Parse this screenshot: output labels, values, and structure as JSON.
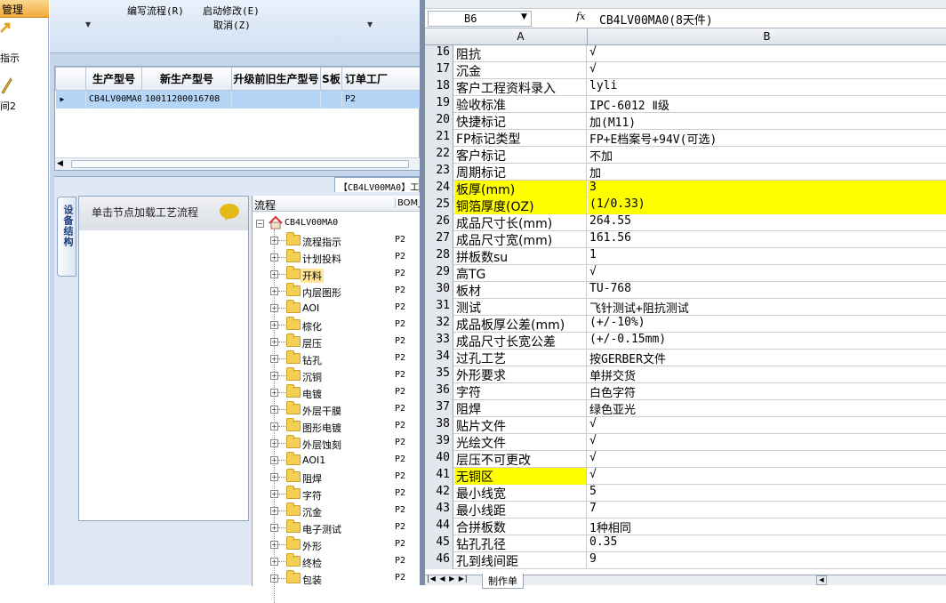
{
  "left_strip": {
    "header": "管理",
    "items": [
      {
        "label": "指示",
        "icon": "task-arrow-icon"
      },
      {
        "label": "间2",
        "icon": "pencil-icon"
      }
    ]
  },
  "ribbon": {
    "items": [
      {
        "label": "编写流程(R)"
      },
      {
        "label": "启动修改(E)"
      },
      {
        "label": "取消(Z)"
      }
    ],
    "dropdown_arrow": "▼"
  },
  "grid": {
    "columns": [
      "生产型号",
      "新生产型号",
      "升级前旧生产型号",
      "S板",
      "订单工厂"
    ],
    "rows": [
      [
        "CB4LV00MA0",
        "10011200016708",
        "",
        "",
        "P2"
      ]
    ]
  },
  "lower": {
    "vertical_tab": "设备结构",
    "top_tab": "【CB4LV00MA0】工",
    "panel_header": "单击节点加载工艺流程",
    "tree": {
      "header_flow": "流程",
      "header_bom": "BOM_",
      "root": "CB4LV00MA0",
      "nodes": [
        {
          "label": "流程指示",
          "bom": "P2"
        },
        {
          "label": "计划投料",
          "bom": "P2"
        },
        {
          "label": "开料",
          "bom": "P2"
        },
        {
          "label": "内层图形",
          "bom": "P2"
        },
        {
          "label": "AOI",
          "bom": "P2"
        },
        {
          "label": "棕化",
          "bom": "P2"
        },
        {
          "label": "层压",
          "bom": "P2"
        },
        {
          "label": "钻孔",
          "bom": "P2"
        },
        {
          "label": "沉铜",
          "bom": "P2"
        },
        {
          "label": "电镀",
          "bom": "P2"
        },
        {
          "label": "外层干膜",
          "bom": "P2"
        },
        {
          "label": "图形电镀",
          "bom": "P2"
        },
        {
          "label": "外层蚀刻",
          "bom": "P2"
        },
        {
          "label": "AOI1",
          "bom": "P2"
        },
        {
          "label": "阻焊",
          "bom": "P2"
        },
        {
          "label": "字符",
          "bom": "P2"
        },
        {
          "label": "沉金",
          "bom": "P2"
        },
        {
          "label": "电子测试",
          "bom": "P2"
        },
        {
          "label": "外形",
          "bom": "P2"
        },
        {
          "label": "终检",
          "bom": "P2"
        },
        {
          "label": "包装",
          "bom": "P2"
        }
      ],
      "highlighted": "开料"
    }
  },
  "sheet": {
    "name_box": "B6",
    "fx": "fx",
    "formula_value": "CB4LV00MA0(8天件)",
    "col_a": "A",
    "col_b": "B",
    "rows": [
      {
        "n": "16",
        "a": "阻抗",
        "b": "√"
      },
      {
        "n": "17",
        "a": "沉金",
        "b": "√"
      },
      {
        "n": "18",
        "a": "客户工程资料录入",
        "b": "lyli"
      },
      {
        "n": "19",
        "a": "验收标准",
        "b": "IPC-6012 Ⅱ级"
      },
      {
        "n": "20",
        "a": "快捷标记",
        "b": "加(M11)"
      },
      {
        "n": "21",
        "a": "FP标记类型",
        "b": "FP+E档案号+94V(可选)"
      },
      {
        "n": "22",
        "a": "客户标记",
        "b": "不加"
      },
      {
        "n": "23",
        "a": "周期标记",
        "b": "加"
      },
      {
        "n": "24",
        "a": "板厚(mm)",
        "b": "3",
        "hl": "row"
      },
      {
        "n": "25",
        "a": "铜箔厚度(OZ)",
        "b": " (1/0.33)",
        "hl": "row"
      },
      {
        "n": "26",
        "a": "成品尺寸长(mm)",
        "b": "264.55"
      },
      {
        "n": "27",
        "a": "成品尺寸宽(mm)",
        "b": "161.56"
      },
      {
        "n": "28",
        "a": "拼板数su",
        "b": "1"
      },
      {
        "n": "29",
        "a": "高TG",
        "b": "√"
      },
      {
        "n": "30",
        "a": "板材",
        "b": "TU-768"
      },
      {
        "n": "31",
        "a": "测试",
        "b": "飞针测试+阻抗测试"
      },
      {
        "n": "32",
        "a": "成品板厚公差(mm)",
        "b": "(+/-10%)"
      },
      {
        "n": "33",
        "a": "成品尺寸长宽公差",
        "b": "(+/-0.15mm)"
      },
      {
        "n": "34",
        "a": "过孔工艺",
        "b": "按GERBER文件"
      },
      {
        "n": "35",
        "a": "外形要求",
        "b": "单拼交货"
      },
      {
        "n": "36",
        "a": "字符",
        "b": "白色字符"
      },
      {
        "n": "37",
        "a": "阻焊",
        "b": "绿色亚光"
      },
      {
        "n": "38",
        "a": "贴片文件",
        "b": "√"
      },
      {
        "n": "39",
        "a": "光绘文件",
        "b": "√"
      },
      {
        "n": "40",
        "a": "层压不可更改",
        "b": "√"
      },
      {
        "n": "41",
        "a": "无铜区",
        "b": "√",
        "hl": "a"
      },
      {
        "n": "42",
        "a": "最小线宽",
        "b": "5"
      },
      {
        "n": "43",
        "a": "最小线距",
        "b": "7"
      },
      {
        "n": "44",
        "a": "合拼板数",
        "b": "1种相同"
      },
      {
        "n": "45",
        "a": "钻孔孔径",
        "b": "0.35"
      },
      {
        "n": "46",
        "a": "孔到线间距",
        "b": "9"
      }
    ],
    "sheet_tab": "制作单",
    "nav_arrows": "|◀ ◀ ▶ ▶|"
  },
  "colors": {
    "highlight_yellow": "#ffff00",
    "selection_blue": "#b5d5f7",
    "tree_highlight": "#fde69a"
  }
}
